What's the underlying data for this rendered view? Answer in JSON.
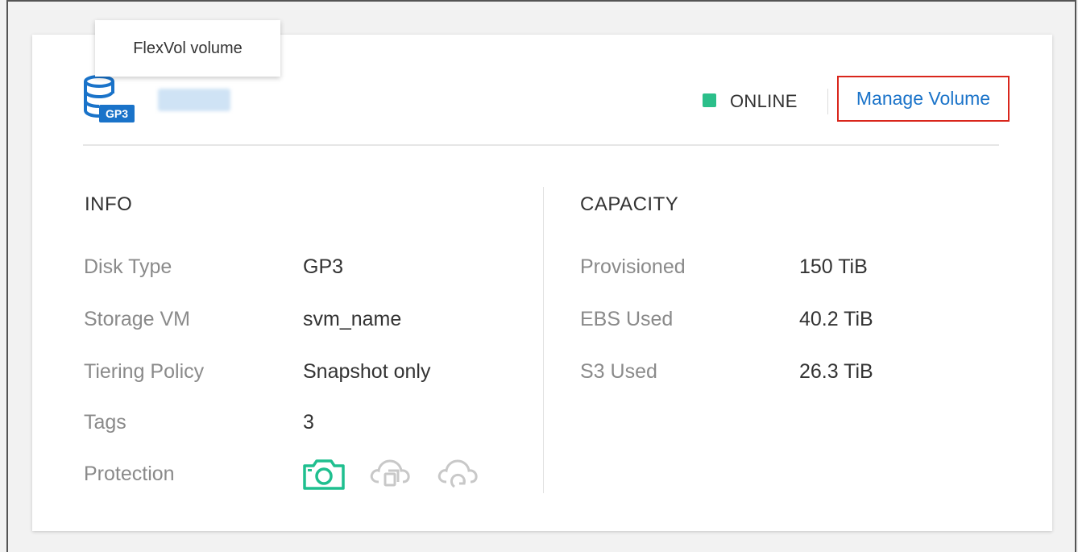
{
  "tooltip": {
    "text": "FlexVol volume"
  },
  "volume": {
    "icon": "database-gp3-icon",
    "disk_badge": "GP3",
    "status": "ONLINE",
    "status_color": "#2bbf8a",
    "manage_label": "Manage Volume"
  },
  "info": {
    "title": "INFO",
    "rows": [
      {
        "label": "Disk Type",
        "value": "GP3"
      },
      {
        "label": "Storage VM",
        "value": "svm_name"
      },
      {
        "label": "Tiering Policy",
        "value": "Snapshot only"
      },
      {
        "label": "Tags",
        "value": "3"
      },
      {
        "label": "Protection",
        "value": ""
      }
    ],
    "protection_icons": [
      {
        "name": "snapshot-camera-icon",
        "active": true
      },
      {
        "name": "cloud-replication-icon",
        "active": false
      },
      {
        "name": "cloud-backup-icon",
        "active": false
      }
    ]
  },
  "capacity": {
    "title": "CAPACITY",
    "rows": [
      {
        "label": "Provisioned",
        "value": "150 TiB"
      },
      {
        "label": "EBS Used",
        "value": "40.2 TiB"
      },
      {
        "label": "S3 Used",
        "value": "26.3 TiB"
      }
    ]
  },
  "colors": {
    "accent": "#1a73c9",
    "highlight_border": "#d9261c",
    "protection_active": "#1fbf8f",
    "protection_inactive": "#c8c8c8"
  }
}
